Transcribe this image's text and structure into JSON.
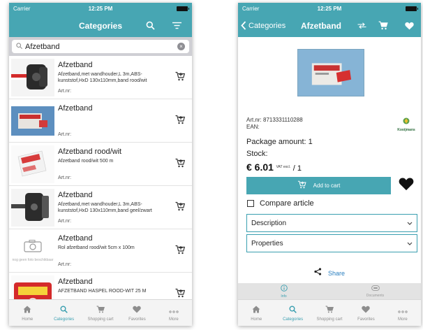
{
  "theme": {
    "teal": "#47a6b3",
    "accent": "#3a9fb0"
  },
  "status": {
    "carrier": "Carrier",
    "time": "12:25 PM"
  },
  "left": {
    "title": "Categories",
    "search_value": "Afzetband",
    "items": [
      {
        "name": "Afzetband",
        "desc": "Afzetband,met wandhouder,L 3m,ABS-kunststof,HxD 130x110mm,band rood/wit",
        "artnr": "Art.nr:"
      },
      {
        "name": "Afzetband",
        "desc": "",
        "artnr": "Art.nr:"
      },
      {
        "name": "Afzetband rood/wit",
        "desc": "Afzetband rood/wit 500 m",
        "artnr": "Art.nr:"
      },
      {
        "name": "Afzetband",
        "desc": "Afzetband,met wandhouder,L 3m,ABS-kunststof,HxD 130x110mm,band geel/zwart",
        "artnr": "Art.nr:"
      },
      {
        "name": "Afzetband",
        "desc": "Rol afzetband rood/wit 5cm x 100m",
        "artnr": "Art.nr:",
        "no_photo_text": "nog geen foto beschikbaar"
      },
      {
        "name": "Afzetband",
        "desc": "AFZETBAND HASPEL ROOD-WIT 25 M",
        "artnr": ""
      }
    ],
    "tabs": [
      "Home",
      "Categories",
      "Shopping cart",
      "Favorites",
      "More"
    ]
  },
  "right": {
    "back_label": "Categories",
    "title": "Afzetband",
    "artnr": "Art.nr: 8713331110288",
    "ean": "EAN:",
    "logo_text": "Kooijmans",
    "package_amount": "Package amount: 1",
    "stock": "Stock:",
    "price": "€ 6.01",
    "vat": "VAT excl.",
    "per": "/ 1",
    "add_to_cart": "Add to cart",
    "compare": "Compare article",
    "description": "Description",
    "properties": "Properties",
    "share": "Share",
    "subtabs": [
      "Info",
      "Documents"
    ],
    "tabs": [
      "Home",
      "Categories",
      "Shopping cart",
      "Favorites",
      "More"
    ]
  },
  "icons": {
    "search": "search-icon",
    "filter": "filter-icon",
    "cart": "cart-icon",
    "heart": "heart-icon",
    "compare": "compare-icon",
    "share": "share-icon",
    "home": "home-icon",
    "more": "more-icon",
    "info": "info-icon",
    "documents": "documents-icon"
  }
}
